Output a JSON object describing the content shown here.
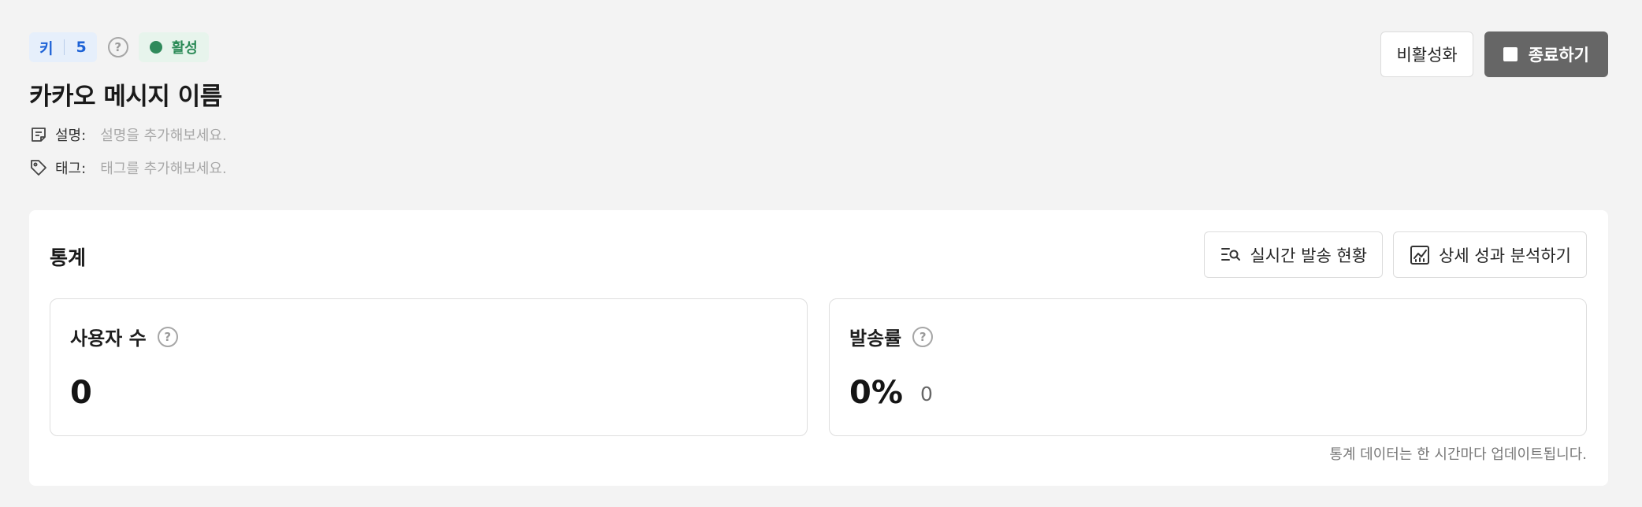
{
  "header": {
    "key_label": "키",
    "key_value": "5",
    "status_label": "활성",
    "title": "카카오 메시지 이름",
    "description_label": "설명:",
    "description_placeholder": "설명을 추가해보세요.",
    "tag_label": "태그:",
    "tag_placeholder": "태그를 추가해보세요.",
    "deactivate_label": "비활성화",
    "end_label": "종료하기"
  },
  "stats": {
    "title": "통계",
    "realtime_label": "실시간 발송 현황",
    "analysis_label": "상세 성과 분석하기",
    "users_label": "사용자 수",
    "users_value": "0",
    "rate_label": "발송률",
    "rate_value": "0%",
    "rate_count": "0",
    "footnote": "통계 데이터는 한 시간마다 업데이트됩니다."
  },
  "colors": {
    "key_badge_bg": "#e6effb",
    "key_badge_text": "#1d62d6",
    "status_bg": "#e7f4ec",
    "status_text": "#2b8a57",
    "end_button_bg": "#666666"
  },
  "icons": {
    "help": "question-circle-icon",
    "status": "status-dot-icon",
    "description": "note-icon",
    "tag": "tag-icon",
    "stop": "stop-icon",
    "realtime": "list-search-icon",
    "analysis": "chart-icon"
  }
}
